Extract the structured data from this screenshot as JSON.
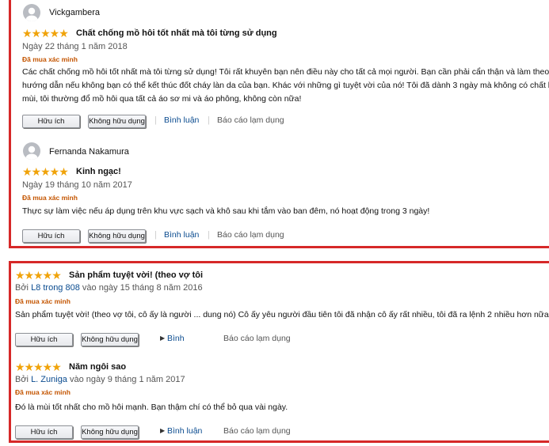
{
  "reviews": [
    {
      "reviewer": "Vickgambera",
      "stars": "★★★★★",
      "rating": 5,
      "title": "Chất chống mồ hôi tốt nhất mà tôi từng sử dụng",
      "date": "Ngày 22 tháng 1 năm 2018",
      "verified": "Đã mua xác minh",
      "body_lines": [
        "Các chất chống mồ hôi tốt nhất mà tôi từng sử dụng! Tôi rất khuyên bạn nên điều này cho tất cả mọi người. Bạn cần phải cẩn thận và làm theo",
        "hướng dẫn nếu không bạn có thể kết thúc đốt cháy làn da của bạn. Khác với những gì tuyệt vời của nó! Tôi đã dành 3 ngày mà không có chất khử",
        "mùi, tôi thường đổ mồ hôi qua tất cả áo sơ mi và áo phông, không còn nữa!"
      ],
      "helpful": "Hữu ích",
      "not_helpful": "Không hữu dụng",
      "separator": "|",
      "comment": "Bình luận",
      "report": "Báo cáo lạm dụng"
    },
    {
      "reviewer": "Fernanda Nakamura",
      "stars": "★★★★★",
      "rating": 5,
      "title": "Kinh ngạc!",
      "date": "Ngày 19 tháng 10 năm 2017",
      "verified": "Đã mua xác minh",
      "body_lines": [
        "Thực sự làm việc nếu áp dụng trên khu vực sạch và khô sau khi tắm vào ban đêm, nó hoạt động trong 3 ngày!"
      ],
      "helpful": "Hữu ích",
      "not_helpful": "Không hữu dụng",
      "separator": "|",
      "comment": "Bình luận",
      "report": "Báo cáo lạm dụng"
    },
    {
      "stars": "★★★★★",
      "rating": 5,
      "title": "Sản phẩm tuyệt vời! (theo vợ tôi",
      "by_prefix": "Bởi",
      "author": "L8 trong 808",
      "date_suffix": "vào ngày 15 tháng 8 năm 2016",
      "verified": "Đã mua xác minh",
      "body_lines": [
        "Sản phẩm tuyệt vời! (theo vợ tôi, cô ấy là người ... dung nó) Cô ấy yêu người đầu tiên tôi đã nhận cô ấy rất nhiều, tôi đã ra lệnh 2 nhiều hơn nữa"
      ],
      "helpful": "Hữu ích",
      "not_helpful": "Không hữu dụng",
      "comment": "Bình",
      "report": "Báo cáo lạm dụng"
    },
    {
      "stars": "★★★★★",
      "rating": 5,
      "title": "Năm ngôi sao",
      "by_prefix": "Bởi",
      "author": "L. Zuniga",
      "date_suffix": "vào ngày 9 tháng 1 năm 2017",
      "verified": "Đã mua xác minh",
      "body_lines": [
        "Đó là mùi tốt nhất cho mồ hôi mạnh. Bạn thậm chí có thể bỏ qua vài ngày."
      ],
      "helpful": "Hữu ích",
      "not_helpful": "Không hữu dụng",
      "comment": "Bình luận",
      "report": "Báo cáo lạm dụng"
    }
  ],
  "icons": {
    "avatar": "user-avatar-icon",
    "star": "star-icon",
    "triangle": "right-triangle-icon"
  },
  "colors": {
    "border": "#d62828",
    "star": "#f0a30a",
    "verified": "#c45500",
    "link": "#0a4b8f"
  }
}
